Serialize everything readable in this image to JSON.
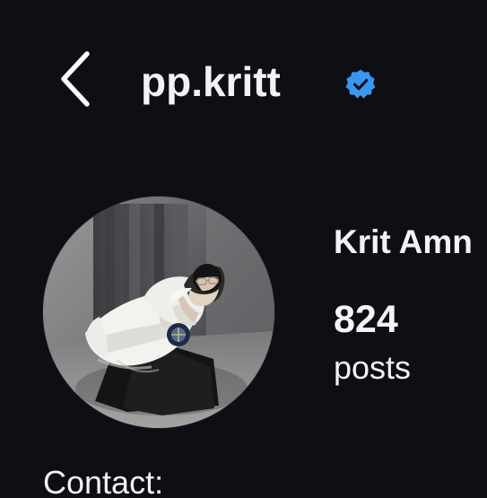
{
  "header": {
    "back_icon": "chevron-left-icon",
    "username": "pp.kritt",
    "verified_icon": "verified-badge-icon",
    "verified_color": "#3897f0"
  },
  "profile": {
    "full_name": "Krit Amn",
    "posts_count": "824",
    "posts_label": "posts",
    "avatar_description": "profile photo"
  },
  "contact": {
    "label": "Contact:"
  }
}
